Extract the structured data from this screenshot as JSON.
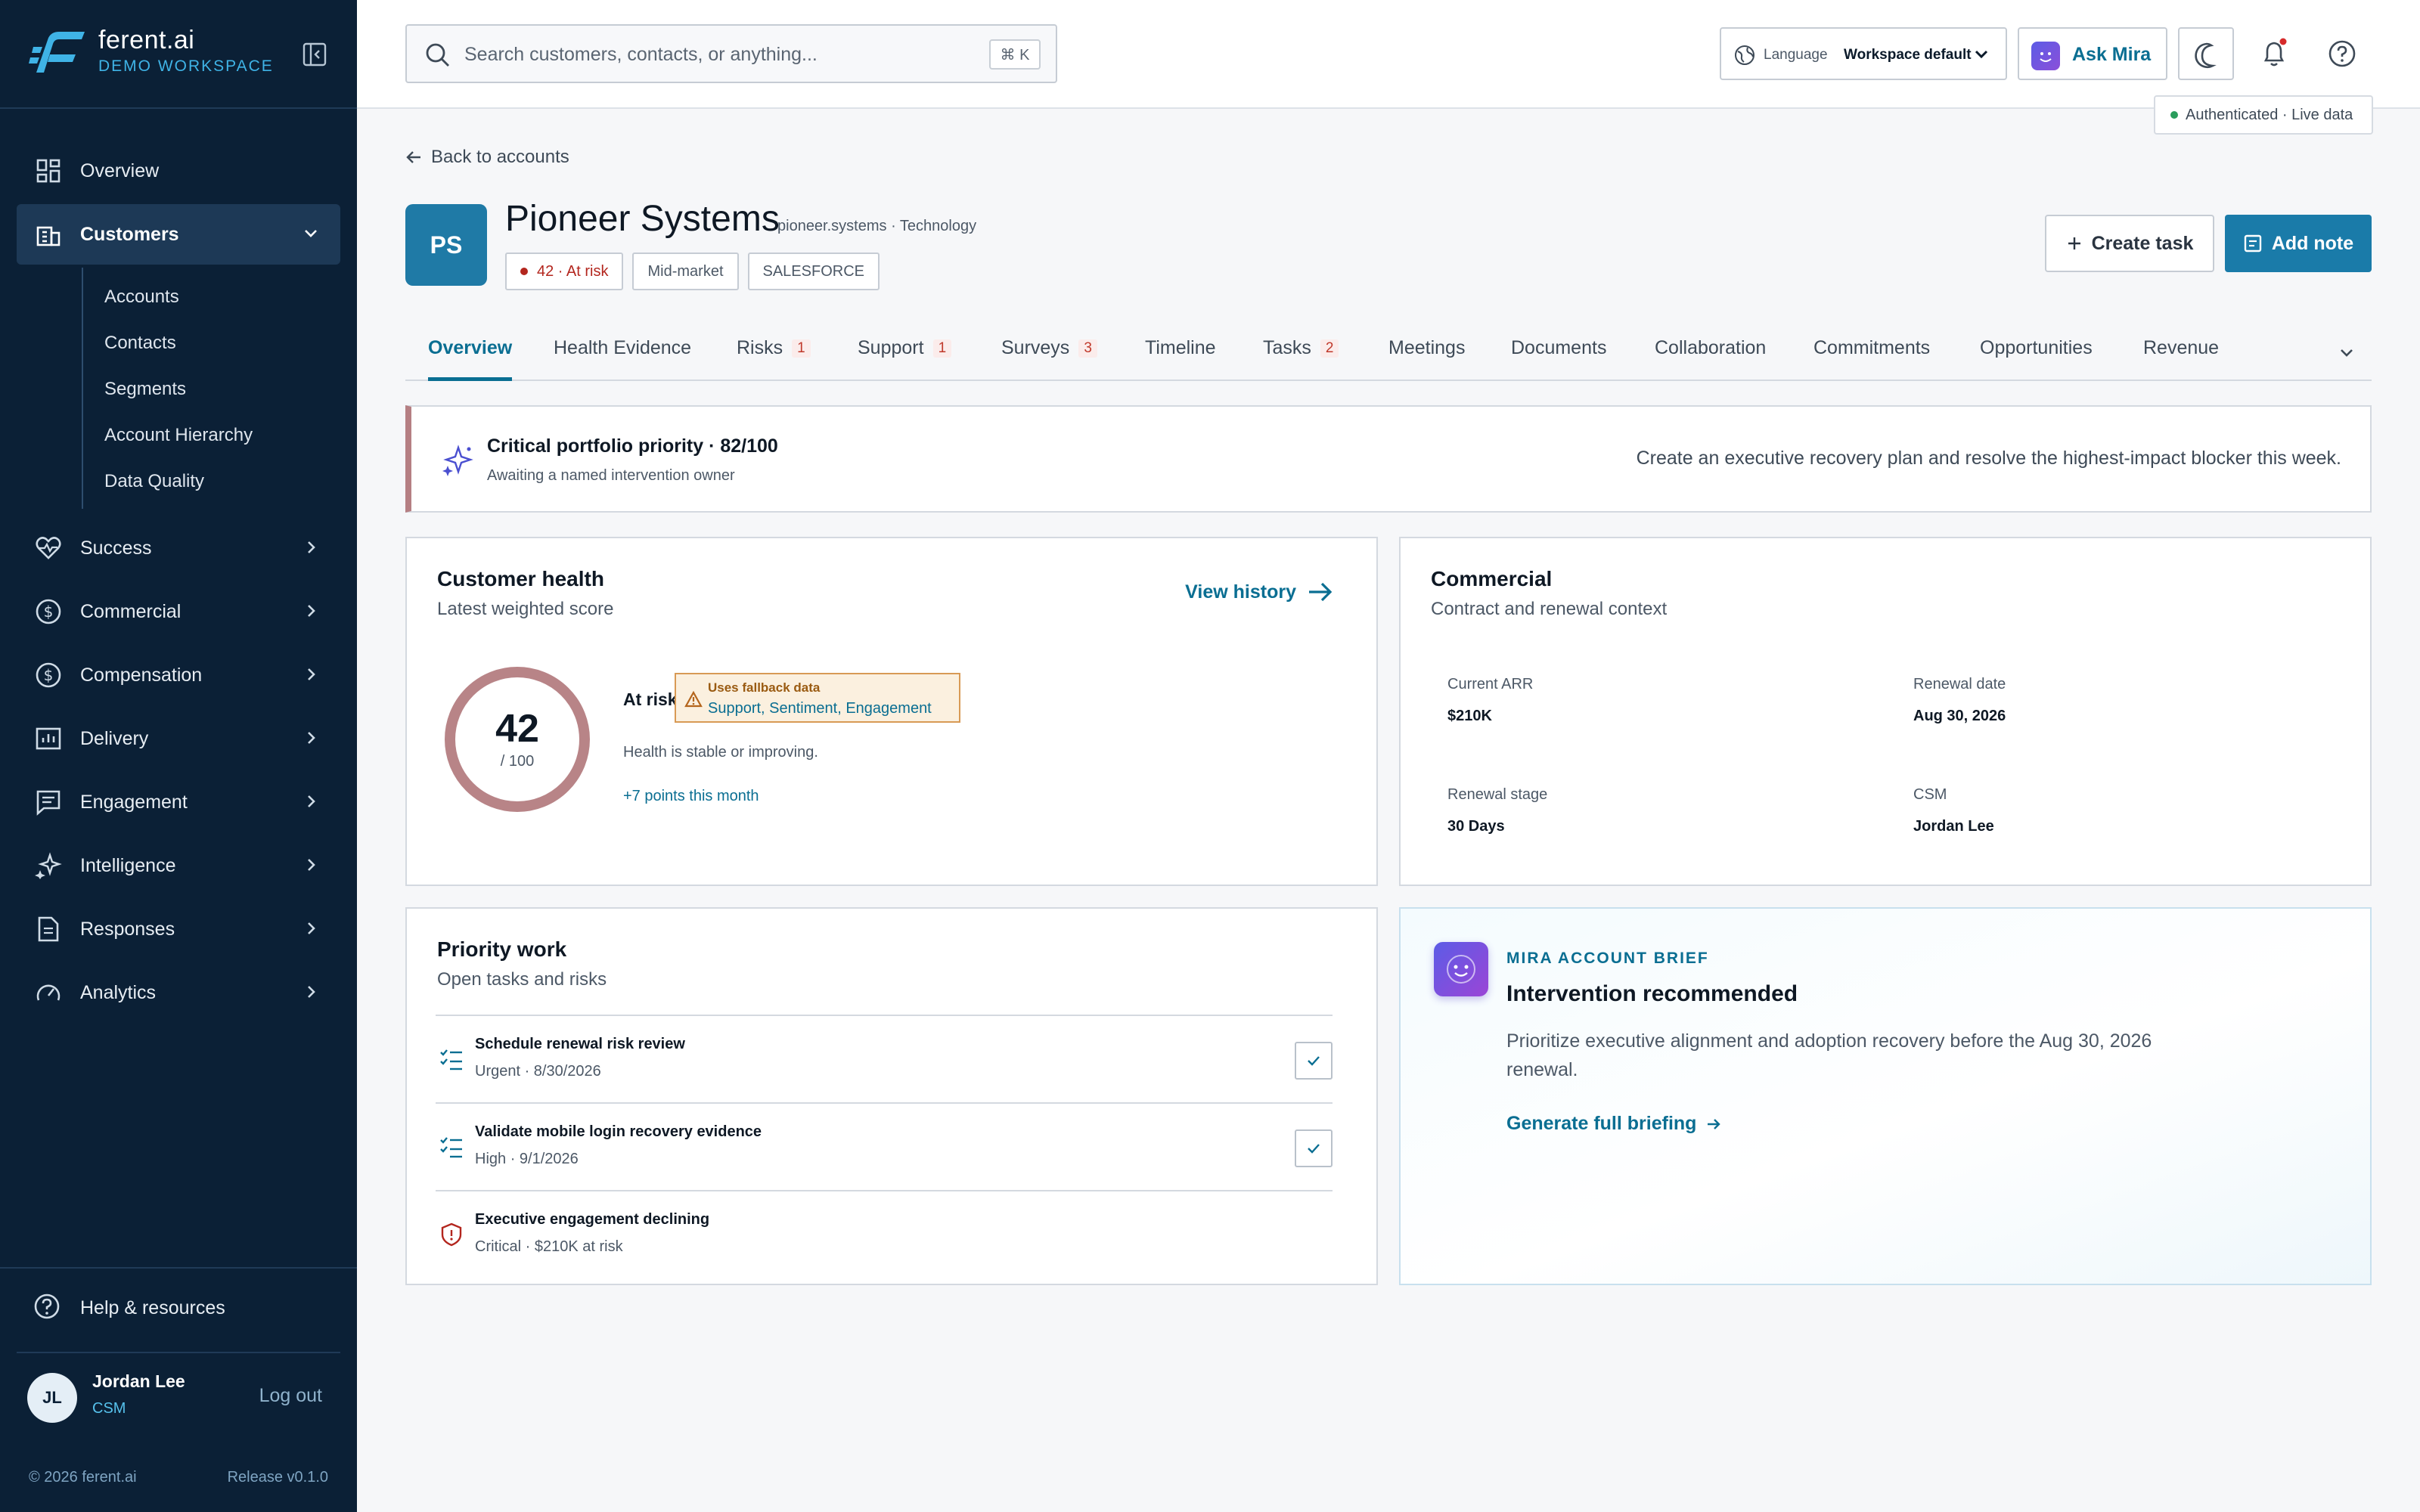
{
  "brand": {
    "name": "ferent.ai",
    "workspace": "DEMO WORKSPACE"
  },
  "sidebar": {
    "items": [
      {
        "label": "Overview",
        "icon": "grid-icon"
      },
      {
        "label": "Customers",
        "icon": "building-icon",
        "expanded": true
      },
      {
        "label": "Success",
        "icon": "heart-icon"
      },
      {
        "label": "Commercial",
        "icon": "dollar-circle-icon"
      },
      {
        "label": "Compensation",
        "icon": "dollar-circle-icon"
      },
      {
        "label": "Delivery",
        "icon": "chart-board-icon"
      },
      {
        "label": "Engagement",
        "icon": "message-square-icon"
      },
      {
        "label": "Intelligence",
        "icon": "sparkles-icon"
      },
      {
        "label": "Responses",
        "icon": "document-icon"
      },
      {
        "label": "Analytics",
        "icon": "gauge-icon"
      }
    ],
    "customers_sub": [
      "Accounts",
      "Contacts",
      "Segments",
      "Account Hierarchy",
      "Data Quality"
    ],
    "help": "Help & resources",
    "user": {
      "initials": "JL",
      "name": "Jordan Lee",
      "role": "CSM"
    },
    "logout": "Log out",
    "footer_left": "© 2026 ferent.ai",
    "footer_right": "Release v0.1.0"
  },
  "topbar": {
    "search_placeholder": "Search customers, contacts, or anything...",
    "shortcut": "⌘ K",
    "language_label": "Language",
    "language_value": "Workspace default",
    "ask_mira": "Ask Mira",
    "status": "Authenticated · Live data"
  },
  "account": {
    "back": "Back to accounts",
    "initials": "PS",
    "name": "Pioneer Systems",
    "meta": "pioneer.systems · Technology",
    "tags": [
      "42 · At risk",
      "Mid-market",
      "SALESFORCE"
    ],
    "create_task": "Create task",
    "add_note": "Add note"
  },
  "tabs": [
    {
      "label": "Overview",
      "count": ""
    },
    {
      "label": "Health Evidence",
      "count": ""
    },
    {
      "label": "Risks",
      "count": "1"
    },
    {
      "label": "Support",
      "count": "1"
    },
    {
      "label": "Surveys",
      "count": "3"
    },
    {
      "label": "Timeline",
      "count": ""
    },
    {
      "label": "Tasks",
      "count": "2"
    },
    {
      "label": "Meetings",
      "count": ""
    },
    {
      "label": "Documents",
      "count": ""
    },
    {
      "label": "Collaboration",
      "count": ""
    },
    {
      "label": "Commitments",
      "count": ""
    },
    {
      "label": "Opportunities",
      "count": ""
    },
    {
      "label": "Revenue",
      "count": ""
    }
  ],
  "banner": {
    "title": "Critical portfolio priority · 82/100",
    "subtitle": "Awaiting a named intervention owner",
    "action": "Create an executive recovery plan and resolve the highest-impact blocker this week."
  },
  "health": {
    "title": "Customer health",
    "subtitle": "Latest weighted score",
    "view_history": "View history",
    "score": "42",
    "score_max": "/ 100",
    "score_fraction": 0.42,
    "status": "At risk",
    "fallback_title": "Uses fallback data",
    "fallback_sources": "Support, Sentiment, Engagement",
    "description": "Health is stable or improving.",
    "delta": "+7 points this month"
  },
  "commercial": {
    "title": "Commercial",
    "subtitle": "Contract and renewal context",
    "fields": [
      {
        "label": "Current ARR",
        "value": "$210K"
      },
      {
        "label": "Renewal date",
        "value": "Aug 30, 2026"
      },
      {
        "label": "Renewal stage",
        "value": "30 Days"
      },
      {
        "label": "CSM",
        "value": "Jordan Lee"
      }
    ]
  },
  "priority": {
    "title": "Priority work",
    "subtitle": "Open tasks and risks",
    "items": [
      {
        "title": "Schedule renewal risk review",
        "meta": "Urgent · 8/30/2026",
        "kind": "task"
      },
      {
        "title": "Validate mobile login recovery evidence",
        "meta": "High · 9/1/2026",
        "kind": "task"
      },
      {
        "title": "Executive engagement declining",
        "meta": "Critical · $210K at risk",
        "kind": "risk"
      }
    ]
  },
  "mira": {
    "kicker": "MIRA ACCOUNT BRIEF",
    "title": "Intervention recommended",
    "body": "Prioritize executive alignment and adoption recovery before the Aug 30, 2026 renewal.",
    "link": "Generate full briefing"
  },
  "colors": {
    "primary": "#1a7ba9",
    "sidebar": "#0b2036",
    "risk": "#b3261e",
    "accent_link": "#0a6e92"
  }
}
